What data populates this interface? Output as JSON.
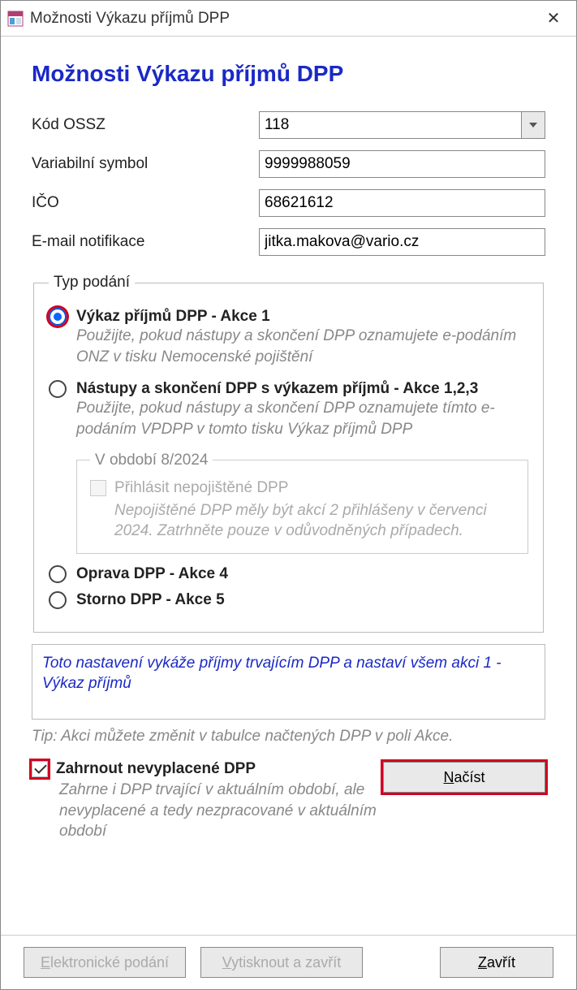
{
  "window": {
    "title": "Možnosti Výkazu příjmů DPP"
  },
  "page": {
    "title": "Možnosti Výkazu příjmů DPP"
  },
  "fields": {
    "kod_ossz": {
      "label": "Kód OSSZ",
      "value": "118"
    },
    "var_symbol": {
      "label": "Variabilní symbol",
      "value": "9999988059"
    },
    "ico": {
      "label": "IČO",
      "value": "68621612"
    },
    "email": {
      "label": "E-mail notifikace",
      "value": "jitka.makova@vario.cz"
    }
  },
  "typ_podani": {
    "legend": "Typ podání",
    "options": [
      {
        "label": "Výkaz příjmů DPP - Akce 1",
        "selected": true,
        "desc": "Použijte, pokud nástupy a skončení DPP oznamujete e-podáním ONZ v tisku Nemocenské pojištění"
      },
      {
        "label": "Nástupy a skončení DPP s výkazem příjmů - Akce 1,2,3",
        "selected": false,
        "desc": "Použijte, pokud nástupy a skončení DPP oznamujete tímto e-podáním VPDPP v tomto tisku Výkaz příjmů DPP"
      },
      {
        "label": "Oprava DPP - Akce 4",
        "selected": false
      },
      {
        "label": "Storno DPP - Akce 5",
        "selected": false
      }
    ],
    "period": {
      "legend": "V období 8/2024",
      "checkbox": "Přihlásit nepojištěné DPP",
      "desc": "Nepojištěné DPP měly být akcí 2 přihlášeny v červenci 2024. Zatrhněte pouze v odůvodněných případech."
    }
  },
  "info": "Toto nastavení vykáže příjmy trvajícím DPP a nastaví všem akci 1 - Výkaz příjmů",
  "tip": "Tip: Akci můžete změnit v tabulce načtených DPP v poli Akce.",
  "include": {
    "label": "Zahrnout nevyplacené DPP",
    "checked": true,
    "desc": "Zahrne i DPP trvající v aktuálním období, ale nevyplacené a tedy nezpracované v aktuálním období"
  },
  "buttons": {
    "nacist": "Načíst",
    "epodani": "Elektronické podání",
    "tisk": "Vytisknout a zavřít",
    "zavrit": "Zavřít"
  }
}
